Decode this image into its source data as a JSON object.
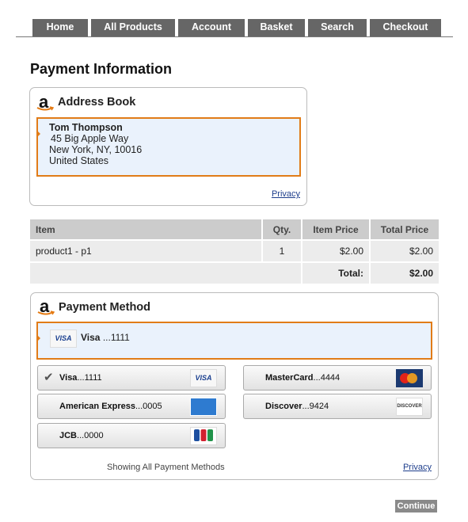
{
  "nav": {
    "tabs": [
      {
        "label": "Home"
      },
      {
        "label": "All Products"
      },
      {
        "label": "Account"
      },
      {
        "label": "Basket"
      },
      {
        "label": "Search"
      },
      {
        "label": "Checkout"
      }
    ]
  },
  "page": {
    "title": "Payment Information"
  },
  "address_book": {
    "title": "Address Book",
    "name": "Tom Thompson",
    "line1": "45 Big Apple Way",
    "line2": "New York, NY, 10016",
    "country": "United States",
    "privacy_label": "Privacy"
  },
  "order_table": {
    "headers": [
      "Item",
      "Qty.",
      "Item Price",
      "Total Price"
    ],
    "rows": [
      {
        "item": "product1 - p1",
        "qty": "1",
        "item_price": "$2.00",
        "total_price": "$2.00"
      }
    ],
    "total_label": "Total:",
    "total_value": "$2.00"
  },
  "payment_method": {
    "title": "Payment Method",
    "selected": {
      "logo": "VISA",
      "brand": "Visa",
      "digits": "...1111"
    },
    "options": [
      {
        "brand": "Visa",
        "digits": "...1111",
        "logo": "VISA",
        "selected": true
      },
      {
        "brand": "MasterCard",
        "digits": "...4444",
        "logo": "mastercard-logo"
      },
      {
        "brand": "American Express",
        "digits": "...0005",
        "logo": "amex-logo"
      },
      {
        "brand": "Discover",
        "digits": "...9424",
        "logo": "DISCOVER"
      },
      {
        "brand": "JCB",
        "digits": "...0000",
        "logo": "jcb-logo"
      }
    ],
    "showing_label": "Showing All Payment Methods",
    "privacy_label": "Privacy"
  },
  "continue_label": "Continue",
  "colors": {
    "accent_orange": "#e17c18",
    "selection_bg": "#eaf2fc",
    "nav_bg": "#666666",
    "link": "#1e3e8c"
  }
}
